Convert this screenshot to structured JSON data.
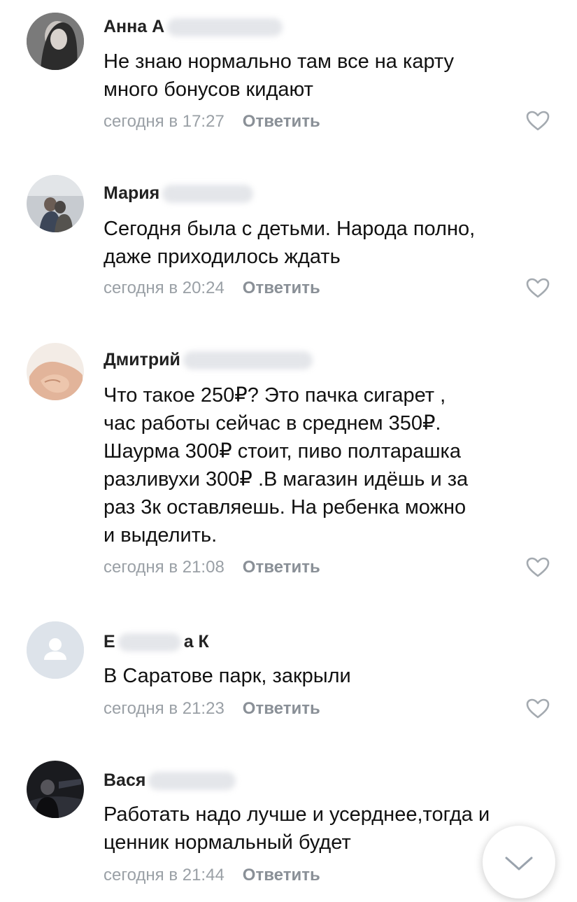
{
  "comments": [
    {
      "author_visible": "Анна А",
      "text_lines": [
        "Не знаю нормально там все на карту",
        "много бонусов кидают"
      ],
      "time": "сегодня в 17:27",
      "reply_label": "Ответить"
    },
    {
      "author_visible": "Мария",
      "text_lines": [
        "Сегодня была с детьми. Народа полно,",
        "даже приходилось ждать"
      ],
      "time": "сегодня в 20:24",
      "reply_label": "Ответить"
    },
    {
      "author_visible": "Дмитрий",
      "text_lines": [
        "Что такое 250₽? Это пачка сигарет ,",
        "час работы сейчас в среднем 350₽.",
        "Шаурма 300₽ стоит, пиво полтарашка",
        "разливухи 300₽ .В магазин идёшь и за",
        "раз 3к оставляешь. На ребенка можно",
        "и выделить."
      ],
      "time": "сегодня в 21:08",
      "reply_label": "Ответить"
    },
    {
      "author_visible_start": "Е",
      "author_visible_end": "а К",
      "text_lines": [
        "В Саратове парк, закрыли"
      ],
      "time": "сегодня в 21:23",
      "reply_label": "Ответить"
    },
    {
      "author_visible": "Вася",
      "text_lines": [
        "Работать надо лучше и усерднее,тогда и",
        "ценник нормальный будет"
      ],
      "time": "сегодня в 21:44",
      "reply_label": "Ответить"
    }
  ],
  "icons": {
    "like": "heart-outline",
    "scroll_down": "chevron-down",
    "default_avatar": "user-silhouette"
  },
  "colors": {
    "meta": "#9aa0a6",
    "heart": "#a4aab0",
    "default_avatar_bg": "#dde3ea"
  }
}
